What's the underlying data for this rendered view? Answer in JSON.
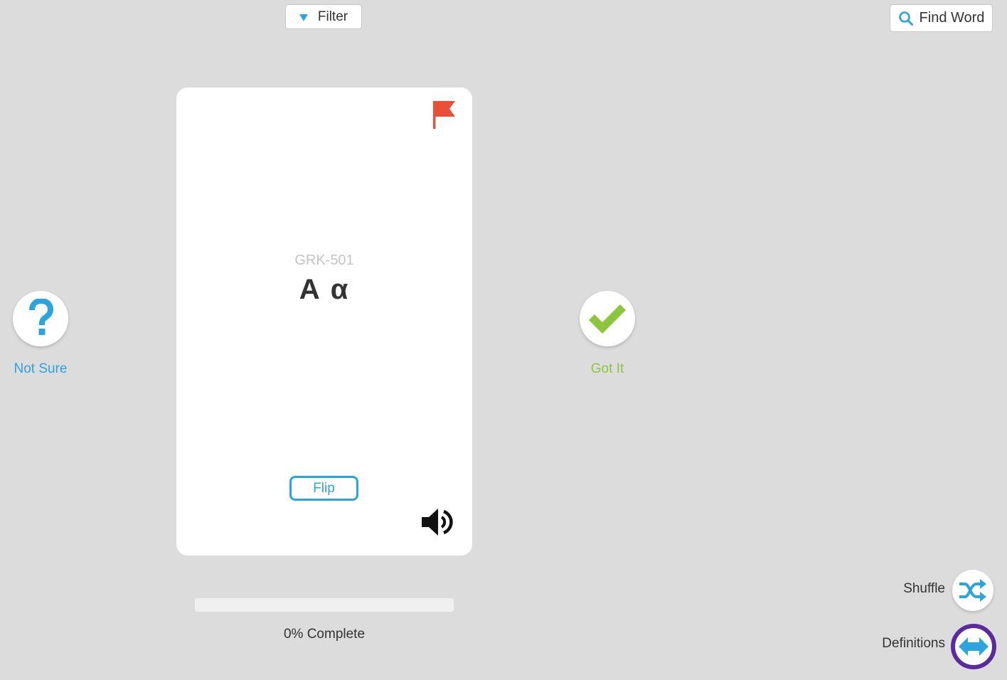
{
  "header": {
    "filter_label": "Filter",
    "find_label": "Find Word"
  },
  "card": {
    "code": "GRK-501",
    "term": "Α α",
    "flip_label": "Flip",
    "flag_icon": "flag-icon",
    "speaker_icon": "speaker-icon"
  },
  "answers": {
    "not_sure_label": "Not Sure",
    "got_it_label": "Got It"
  },
  "progress": {
    "percent": 0,
    "text": "0% Complete"
  },
  "controls": {
    "shuffle_label": "Shuffle",
    "definitions_label": "Definitions"
  },
  "colors": {
    "accent_blue": "#2aa5dd",
    "success_green": "#8cc63f",
    "flag_red": "#e8503a",
    "definitions_ring": "#5b2a9e",
    "background": "#dcdcdc"
  }
}
